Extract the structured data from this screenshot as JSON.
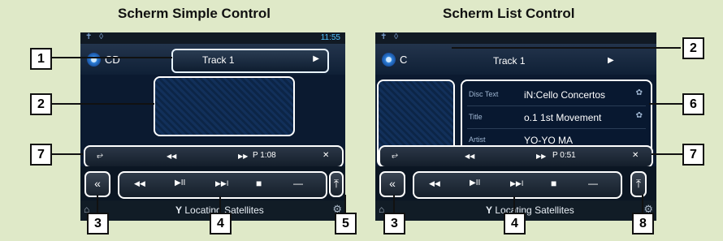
{
  "titles": {
    "simple": "Scherm Simple Control",
    "list": "Scherm List Control"
  },
  "status": {
    "time": "11:55",
    "icons": "✝ ◊"
  },
  "source": {
    "label": "CD",
    "list_label": "C"
  },
  "track": {
    "simple": "Track  1",
    "list": "Track  1",
    "arrow": "▶"
  },
  "info": [
    {
      "key": "Disc Text",
      "value": "iN:Cello Concertos",
      "icon": "✿"
    },
    {
      "key": "Title",
      "value": "o.1 1st Movement",
      "icon": "✿"
    },
    {
      "key": "Artist",
      "value": "YO-YO MA"
    }
  ],
  "playbar": {
    "repeat": "⥂",
    "rewind": "◀◀",
    "ffwd": "▶▶",
    "simple_time": "P 1:08",
    "list_time": "P 0:51",
    "shuffle": "✕"
  },
  "controls": {
    "back": "«",
    "prev": "◀◀",
    "play_pause": "▶II",
    "next": "▶▶I",
    "stop": "■",
    "dash": "—",
    "eject": "⤒"
  },
  "nav": {
    "text": "Locating Satellites",
    "icon": "Y",
    "settings_icon": "⚙",
    "left_icon": "⌂"
  },
  "callouts": {
    "n1": "1",
    "n2": "2",
    "n3": "3",
    "n4": "4",
    "n5": "5",
    "n6": "6",
    "n7": "7",
    "n8": "8"
  }
}
